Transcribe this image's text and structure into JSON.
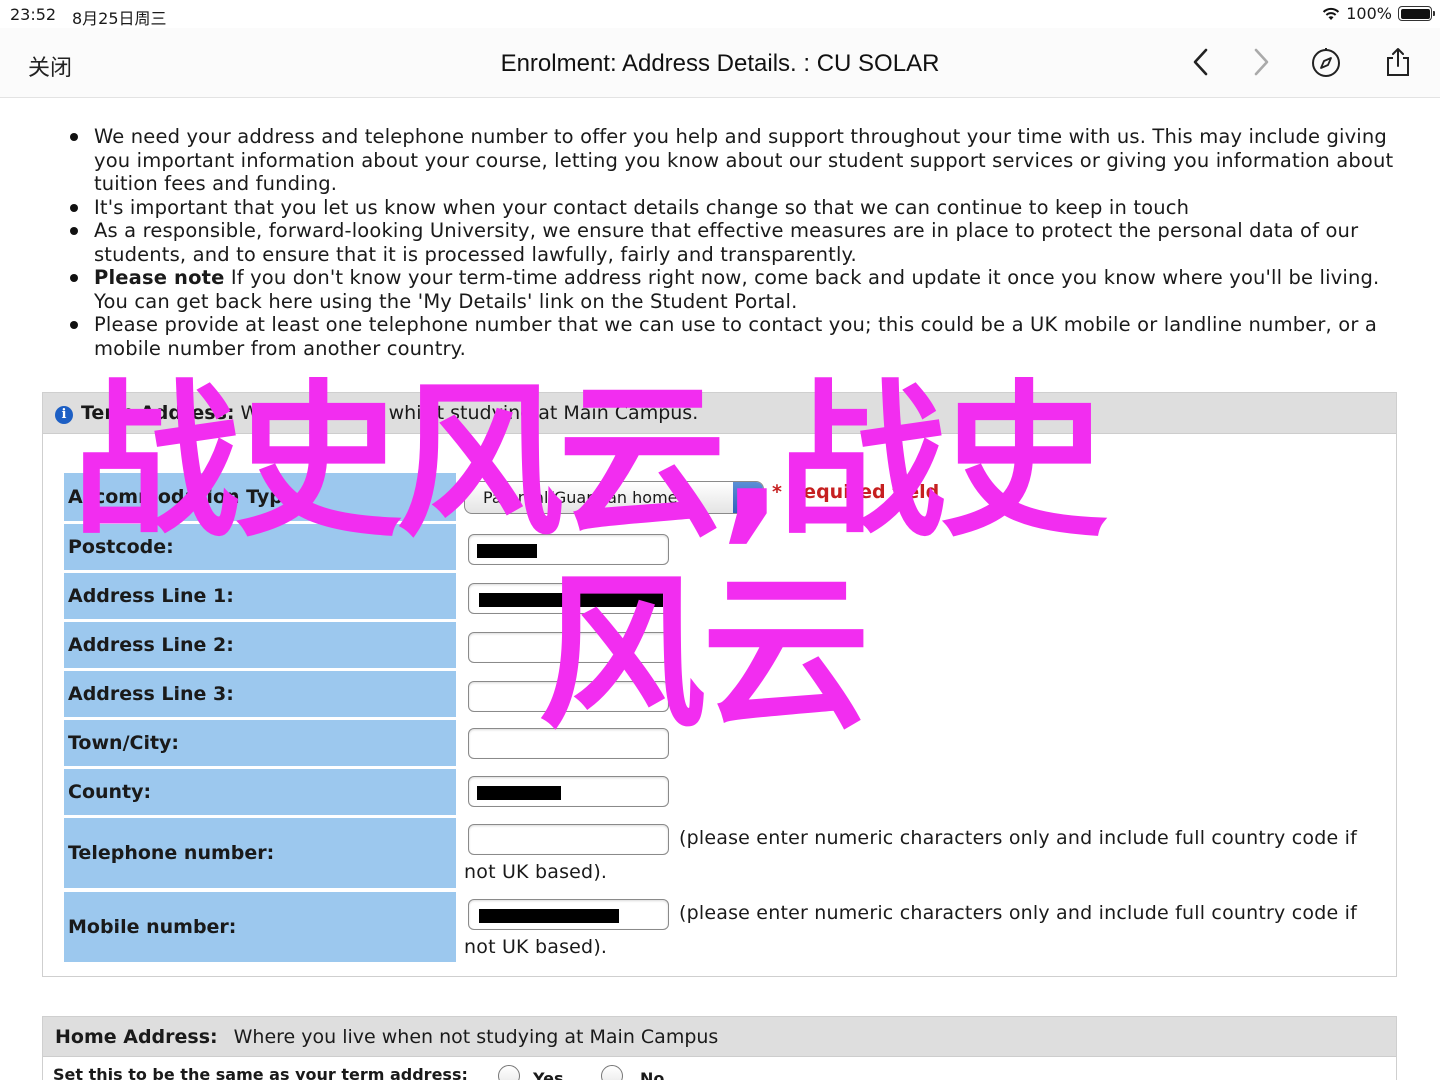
{
  "status_bar": {
    "time": "23:52",
    "date": "8月25日周三",
    "battery": "100%"
  },
  "nav": {
    "close_label": "关闭",
    "title": "Enrolment: Address Details. : CU SOLAR"
  },
  "bullets": [
    "We need your address and telephone number to offer you help and support throughout your time with us. This may include giving you important information about your course, letting you know about our student support services or giving you information about tuition fees and funding.",
    "It's important that you let us know when your contact details change so that we can continue to keep in touch",
    "As a responsible, forward-looking University, we ensure that effective measures are in place to protect the personal data of our students, and to ensure that it is processed lawfully, fairly and transparently.",
    {
      "bold": "Please note",
      "text": " If you don't know your term-time address right now, come back and update it once you know where you'll be living. You can get back here using the 'My Details' link on the Student Portal."
    },
    "Please provide at least one telephone number that we can use to contact you; this could be a UK mobile or landline number, or a mobile number from another country."
  ],
  "term_address": {
    "heading": "Term Address:",
    "subheading": "Where you live whilst studying at Main Campus.",
    "accommodation_label": "Accommodation Type",
    "accommodation_value": "Parental/Guardian home",
    "required_text": "* Required field",
    "postcode_label": "Postcode:",
    "address1_label": "Address Line 1:",
    "address2_label": "Address Line 2:",
    "address3_label": "Address Line 3:",
    "town_label": "Town/City:",
    "county_label": "County:",
    "telephone_label": "Telephone number:",
    "mobile_label": "Mobile number:",
    "phone_hint_line1": "(please enter numeric characters only and include full country code if",
    "phone_hint_line2": "not UK based)."
  },
  "home_address": {
    "heading": "Home Address:",
    "subheading": "Where you live when not studying at Main Campus",
    "same_as_term_label": "Set this to be the same as your term address:",
    "yes_label": "Yes",
    "no_label": "No"
  },
  "watermark": {
    "line1": "战史风云,战史",
    "line2": "风云"
  },
  "colors": {
    "label_bg": "#9cc8ee",
    "panel_head_bg": "#dedede",
    "required": "#c62020",
    "watermark": "#f22df0"
  }
}
